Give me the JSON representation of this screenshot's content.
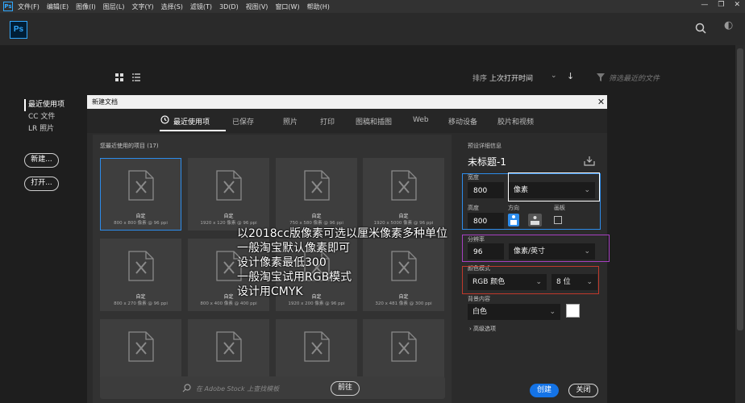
{
  "menubar": {
    "items": [
      "文件(F)",
      "编辑(E)",
      "图像(I)",
      "图层(L)",
      "文字(Y)",
      "选择(S)",
      "滤镜(T)",
      "3D(D)",
      "视图(V)",
      "窗口(W)",
      "帮助(H)"
    ],
    "window_controls": [
      "—",
      "❐",
      "✕"
    ]
  },
  "app": {
    "logo": "Ps",
    "mini_logo": "Ps"
  },
  "home": {
    "sort_label": "排序",
    "sort_value": "上次打开时间",
    "filter_placeholder": "筛选最近的文件",
    "nav": [
      "最近使用项",
      "CC 文件",
      "LR 照片"
    ],
    "new_button": "新建...",
    "open_button": "打开..."
  },
  "dialog": {
    "title": "新建文档",
    "tabs": [
      "最近使用项",
      "已保存",
      "照片",
      "打印",
      "图稿和插图",
      "Web",
      "移动设备",
      "胶片和视频"
    ],
    "active_tab": 0,
    "recent_title": "您最近使用的项目  (17)",
    "cards": [
      {
        "name": "自定",
        "size": "800 x 800 像素 @ 96 ppi"
      },
      {
        "name": "自定",
        "size": "1920 x 120 像素 @ 96 ppi"
      },
      {
        "name": "自定",
        "size": "750 x 580 像素 @ 96 ppi"
      },
      {
        "name": "自定",
        "size": "1920 x 5000 像素 @ 96 ppi"
      },
      {
        "name": "自定",
        "size": "800 x 270 像素 @ 96 ppi"
      },
      {
        "name": "自定",
        "size": "800 x 400 像素 @ 400 ppi"
      },
      {
        "name": "自定",
        "size": "1920 x 200 像素 @ 96 ppi"
      },
      {
        "name": "自定",
        "size": "320 x 481 像素 @ 300 ppi"
      },
      {
        "name": "",
        "size": ""
      },
      {
        "name": "",
        "size": ""
      },
      {
        "name": "",
        "size": ""
      },
      {
        "name": "",
        "size": ""
      }
    ],
    "stock_placeholder": "在 Adobe Stock 上查找模板",
    "stock_go": "前往",
    "preset": {
      "section_label": "预设详细信息",
      "name": "未标题-1",
      "width_label": "宽度",
      "width_value": "800",
      "width_unit": "像素",
      "height_label": "高度",
      "height_value": "800",
      "orientation_label": "方向",
      "artboard_label": "画板",
      "resolution_label": "分辨率",
      "resolution_value": "96",
      "resolution_unit": "像素/英寸",
      "colormode_label": "颜色模式",
      "colormode_value": "RGB 颜色",
      "bitdepth_value": "8 位",
      "bg_label": "背景内容",
      "bg_value": "白色",
      "advanced_label": "高级选项"
    },
    "create_button": "创建",
    "close_button": "关闭"
  },
  "overlay": [
    "以2018cc版像素可选以厘米像素多种单位",
    "一般淘宝默认像素即可",
    "设计像素最低300",
    "一般淘宝试用RGB模式",
    "设计用CMYK"
  ],
  "colors": {
    "accent": "#1473e6",
    "ps_blue": "#31a8ff",
    "width_box": "#ffffff",
    "width_frame": "#2d8ceb",
    "resolution_box": "#a640c0",
    "colormode_box": "#c0392b"
  }
}
